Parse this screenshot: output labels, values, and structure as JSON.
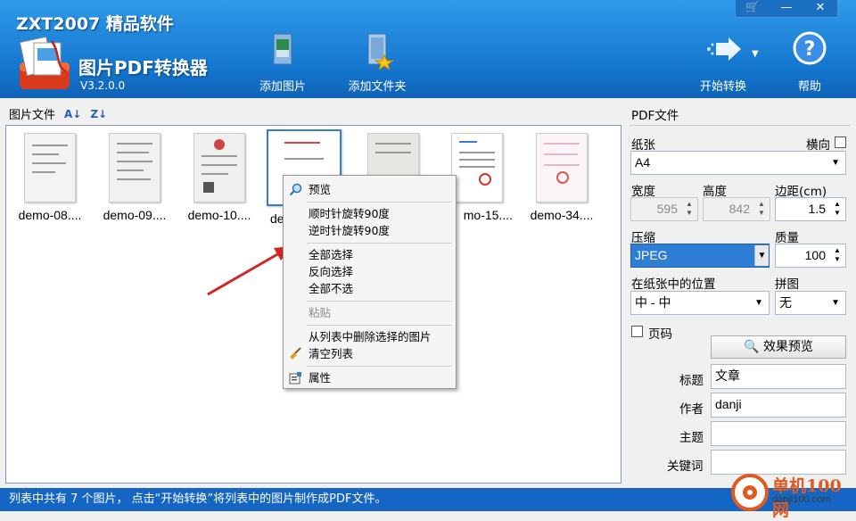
{
  "header": {
    "brand": "ZXT2007 精品软件",
    "product_name": "图片PDF转换器",
    "version": "V3.2.0.0",
    "toolbar": [
      {
        "label": "添加图片"
      },
      {
        "label": "添加文件夹"
      },
      {
        "label": "开始转换"
      },
      {
        "label": "帮助"
      }
    ]
  },
  "window_controls": {
    "cart": "🛒",
    "minimize": "—",
    "close": "✕"
  },
  "left": {
    "title": "图片文件",
    "thumbnails": [
      {
        "name": "demo-08...."
      },
      {
        "name": "demo-09...."
      },
      {
        "name": "demo-10...."
      },
      {
        "name": "de"
      },
      {
        "name": ""
      },
      {
        "name": "mo-15...."
      },
      {
        "name": "demo-34...."
      }
    ]
  },
  "context_menu": {
    "preview": "预览",
    "rotate_cw": "顺时针旋转90度",
    "rotate_ccw": "逆时针旋转90度",
    "select_all": "全部选择",
    "invert_select": "反向选择",
    "select_none": "全部不选",
    "paste": "粘贴",
    "remove_selected": "从列表中删除选择的图片",
    "clear_list": "清空列表",
    "properties": "属性"
  },
  "right": {
    "title": "PDF文件",
    "paper_label": "纸张",
    "landscape_label": "横向",
    "paper_value": "A4",
    "width_label": "宽度",
    "height_label": "高度",
    "margin_label": "边距(cm)",
    "width_value": "595",
    "height_value": "842",
    "margin_value": "1.5",
    "compress_label": "压缩",
    "quality_label": "质量",
    "compress_value": "JPEG",
    "quality_value": "100",
    "position_label": "在纸张中的位置",
    "tile_label": "拼图",
    "position_value": "中 - 中",
    "tile_value": "无",
    "page_number_label": "页码",
    "preview_button": "效果预览",
    "title_label": "标题",
    "title_value": "文章",
    "author_label": "作者",
    "author_value": "danji",
    "subject_label": "主题",
    "subject_value": "",
    "keywords_label": "关键词",
    "keywords_value": ""
  },
  "status": "列表中共有 7 个图片， 点击“开始转换”将列表中的图片制作成PDF文件。",
  "watermark": {
    "name": "单机100网",
    "url": "danji100.com"
  }
}
